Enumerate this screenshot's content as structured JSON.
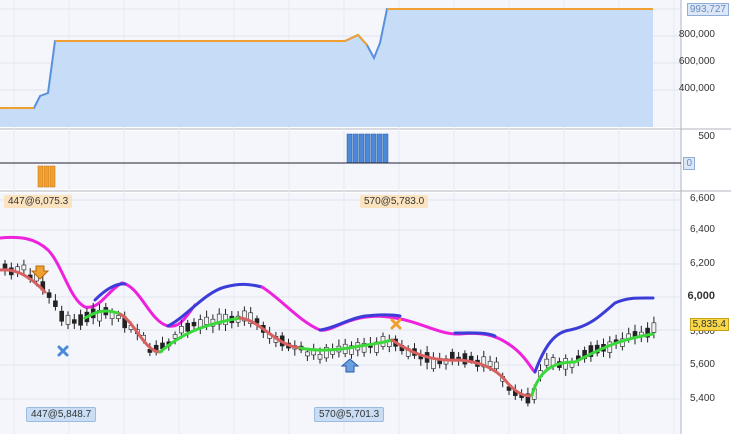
{
  "equity_panel": {
    "ticks": [
      "400,000",
      "600,000",
      "800,000"
    ],
    "last_value_label": "993,727"
  },
  "signal_panel": {
    "ticks": [
      "500"
    ],
    "zero_label": "0"
  },
  "price_panel": {
    "ticks": [
      "5,400",
      "5,600",
      "5,800",
      "6,000",
      "6,200",
      "6,400",
      "6,600"
    ],
    "last_price_label": "5,835.4",
    "trades": {
      "trade1_top": "447@6,075.3",
      "trade2_top": "570@5,783.0",
      "trade1_bottom": "447@5,848.7",
      "trade2_bottom": "570@5,701.3"
    }
  },
  "colors": {
    "equity_fill": "#c6dcf7",
    "equity_line": "#f0a030",
    "ma_up": "#3c3cd8",
    "ma_down": "#ee22dd",
    "candle_up": "#3ad83a",
    "candle_down": "#d86060",
    "signal_bar_orange": "#f0a030",
    "signal_bar_blue": "#4a8ad8"
  }
}
